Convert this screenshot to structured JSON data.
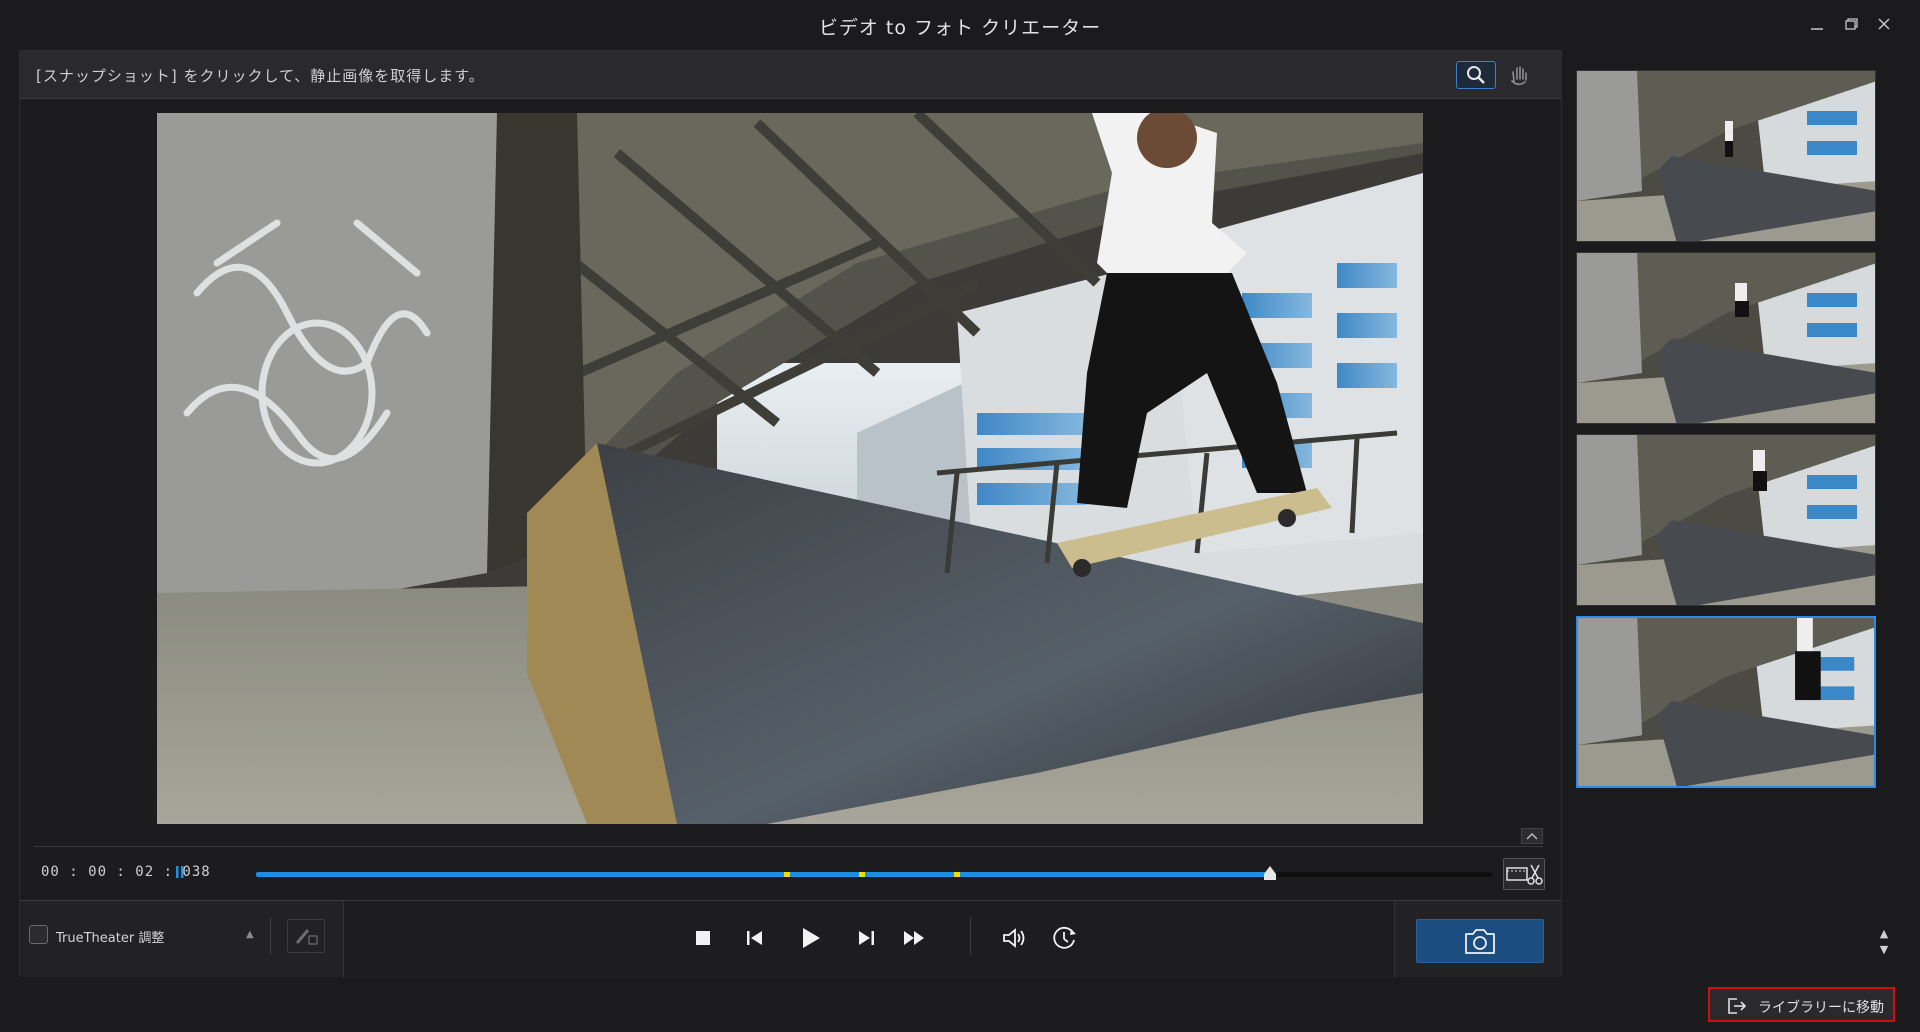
{
  "window": {
    "title": "ビデオ to フォト クリエーター",
    "controls": [
      "minimize-icon",
      "restore-icon",
      "close-icon"
    ]
  },
  "hint": "[スナップショット] をクリックして、静止画像を取得します。",
  "tools": {
    "zoom_active": true,
    "icons": [
      "zoom-icon",
      "hand-pan-icon"
    ]
  },
  "timeline": {
    "timecode": "00 : 00 : 02 : 038",
    "progress": 0.82,
    "markers": [
      0.43,
      0.49,
      0.567
    ],
    "colors": {
      "progress": "#1a8fe3",
      "marker": "#f2dd00"
    }
  },
  "controls": {
    "truetheater_label": "TrueTheater 調整",
    "truetheater_checked": false,
    "icons": [
      "stop-icon",
      "previous-frame-icon",
      "play-icon",
      "next-frame-icon",
      "fast-forward-icon",
      "volume-icon",
      "burst-timer-icon",
      "camera-icon"
    ]
  },
  "thumbnails": {
    "count": 4,
    "selected_index": 3
  },
  "footer": {
    "library_button": "ライブラリーに移動",
    "icon": "export-icon"
  }
}
